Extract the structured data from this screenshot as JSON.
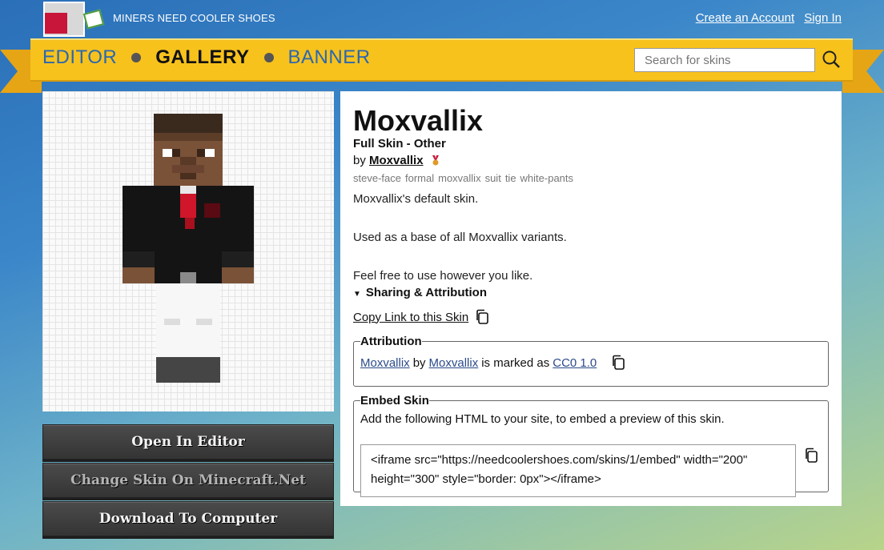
{
  "header": {
    "site_name": "MINERS NEED COOLER SHOES",
    "create_account": "Create an Account",
    "sign_in": "Sign In"
  },
  "nav": {
    "items": [
      {
        "label": "EDITOR",
        "active": false
      },
      {
        "label": "GALLERY",
        "active": true
      },
      {
        "label": "BANNER",
        "active": false
      }
    ],
    "search_placeholder": "Search for skins"
  },
  "skin": {
    "title": "Moxvallix",
    "type": "Full Skin - Other",
    "by_prefix": "by",
    "author": "Moxvallix",
    "tags": [
      "steve-face",
      "formal",
      "moxvallix",
      "suit",
      "tie",
      "white-pants"
    ],
    "description": [
      "Moxvallix's default skin.",
      "Used as a base of all Moxvallix variants.",
      "Feel free to use however you like."
    ]
  },
  "actions": {
    "open_editor": "Open In Editor",
    "change_skin": "Change Skin On Minecraft.Net",
    "download": "Download To Computer"
  },
  "sharing": {
    "summary": "Sharing & Attribution",
    "copy_link": "Copy Link to this Skin",
    "attribution_legend": "Attribution",
    "attr_name": "Moxvallix",
    "attr_by": "by",
    "attr_author": "Moxvallix",
    "attr_marked": "is marked as",
    "attr_license": "CC0 1.0",
    "embed_legend": "Embed Skin",
    "embed_desc": "Add the following HTML to your site, to embed a preview of this skin.",
    "embed_code": "<iframe src=\"https://needcoolershoes.com/skins/1/embed\" width=\"200\" height=\"300\" style=\"border: 0px\"></iframe>"
  },
  "colors": {
    "nav_yellow": "#f7c21c",
    "nav_link": "#2b67b0",
    "suit_black": "#141414",
    "tie_red": "#d0162a",
    "skin_brown": "#7a5238"
  }
}
